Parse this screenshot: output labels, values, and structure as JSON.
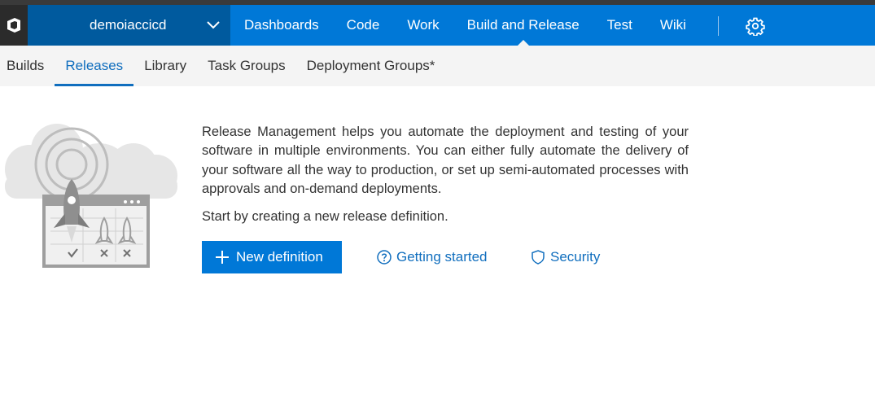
{
  "colors": {
    "brand_blue": "#0078d7",
    "account_blue": "#005a9e",
    "link_blue": "#106ebe",
    "subnav_bg": "#f4f4f4"
  },
  "topbar": {
    "logo_icon": "vsts-logo-icon",
    "account": {
      "name": "demoiaccicd",
      "icon": "chevron-down-icon"
    },
    "hubs": [
      {
        "label": "Dashboards"
      },
      {
        "label": "Code"
      },
      {
        "label": "Work"
      },
      {
        "label": "Build and Release",
        "active": true
      },
      {
        "label": "Test"
      },
      {
        "label": "Wiki"
      }
    ],
    "settings_icon": "gear-icon"
  },
  "subnav": {
    "tabs": [
      {
        "label": "Builds"
      },
      {
        "label": "Releases",
        "active": true
      },
      {
        "label": "Library"
      },
      {
        "label": "Task Groups"
      },
      {
        "label": "Deployment Groups*"
      }
    ]
  },
  "main": {
    "illustration_icon": "release-rocket-illustration",
    "description": "Release Management helps you automate the deployment and testing of your software in multiple environments. You can either fully automate the delivery of your software all the way to production, or set up semi-automated processes with approvals and on-demand deployments.",
    "start_text": "Start by creating a new release definition.",
    "new_definition": {
      "label": "New definition",
      "icon": "plus-icon"
    },
    "getting_started": {
      "label": "Getting started",
      "icon": "question-circle-icon"
    },
    "security": {
      "label": "Security",
      "icon": "shield-icon"
    }
  }
}
